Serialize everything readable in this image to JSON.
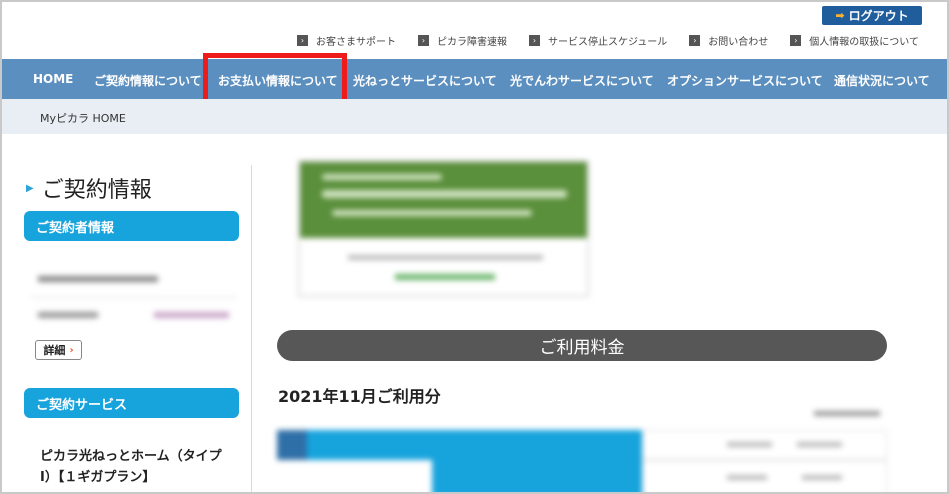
{
  "header": {
    "logout_label": "ログアウト",
    "utility_links": [
      "お客さまサポート",
      "ピカラ障害速報",
      "サービス停止スケジュール",
      "お問い合わせ",
      "個人情報の取扱について"
    ]
  },
  "nav": {
    "items": [
      "HOME",
      "ご契約情報について",
      "お支払い情報について",
      "光ねっとサービスについて",
      "光でんわサービスについて",
      "オプションサービスについて",
      "通信状況について"
    ],
    "highlighted_index": 2
  },
  "breadcrumb": {
    "text": "Myピカラ HOME"
  },
  "sidebar": {
    "title": "ご契約情報",
    "contractor_header": "ご契約者情報",
    "detail_button": "詳細",
    "services_header": "ご契約サービス",
    "service_name": "ピカラ光ねっとホーム（タイプⅠ）【１ギガプラン】"
  },
  "main": {
    "usage_header": "ご利用料金",
    "month_label": "2021年11月ご利用分"
  },
  "colors": {
    "nav_bg": "#5b8fbf",
    "highlight": "#ee1b1b",
    "pill": "#17a3dc",
    "logout": "#1f5d9c"
  }
}
